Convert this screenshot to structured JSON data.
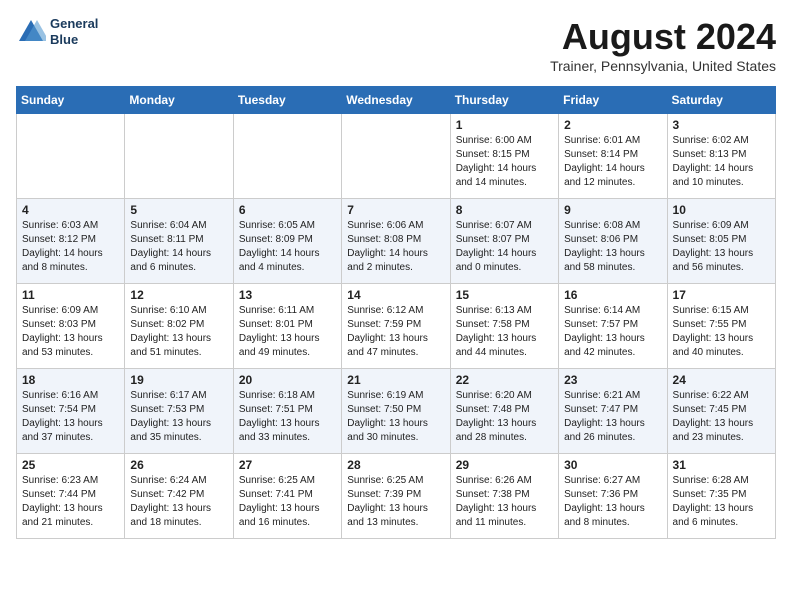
{
  "header": {
    "logo_line1": "General",
    "logo_line2": "Blue",
    "month": "August 2024",
    "location": "Trainer, Pennsylvania, United States"
  },
  "days_of_week": [
    "Sunday",
    "Monday",
    "Tuesday",
    "Wednesday",
    "Thursday",
    "Friday",
    "Saturday"
  ],
  "weeks": [
    [
      {
        "day": "",
        "info": ""
      },
      {
        "day": "",
        "info": ""
      },
      {
        "day": "",
        "info": ""
      },
      {
        "day": "",
        "info": ""
      },
      {
        "day": "1",
        "info": "Sunrise: 6:00 AM\nSunset: 8:15 PM\nDaylight: 14 hours\nand 14 minutes."
      },
      {
        "day": "2",
        "info": "Sunrise: 6:01 AM\nSunset: 8:14 PM\nDaylight: 14 hours\nand 12 minutes."
      },
      {
        "day": "3",
        "info": "Sunrise: 6:02 AM\nSunset: 8:13 PM\nDaylight: 14 hours\nand 10 minutes."
      }
    ],
    [
      {
        "day": "4",
        "info": "Sunrise: 6:03 AM\nSunset: 8:12 PM\nDaylight: 14 hours\nand 8 minutes."
      },
      {
        "day": "5",
        "info": "Sunrise: 6:04 AM\nSunset: 8:11 PM\nDaylight: 14 hours\nand 6 minutes."
      },
      {
        "day": "6",
        "info": "Sunrise: 6:05 AM\nSunset: 8:09 PM\nDaylight: 14 hours\nand 4 minutes."
      },
      {
        "day": "7",
        "info": "Sunrise: 6:06 AM\nSunset: 8:08 PM\nDaylight: 14 hours\nand 2 minutes."
      },
      {
        "day": "8",
        "info": "Sunrise: 6:07 AM\nSunset: 8:07 PM\nDaylight: 14 hours\nand 0 minutes."
      },
      {
        "day": "9",
        "info": "Sunrise: 6:08 AM\nSunset: 8:06 PM\nDaylight: 13 hours\nand 58 minutes."
      },
      {
        "day": "10",
        "info": "Sunrise: 6:09 AM\nSunset: 8:05 PM\nDaylight: 13 hours\nand 56 minutes."
      }
    ],
    [
      {
        "day": "11",
        "info": "Sunrise: 6:09 AM\nSunset: 8:03 PM\nDaylight: 13 hours\nand 53 minutes."
      },
      {
        "day": "12",
        "info": "Sunrise: 6:10 AM\nSunset: 8:02 PM\nDaylight: 13 hours\nand 51 minutes."
      },
      {
        "day": "13",
        "info": "Sunrise: 6:11 AM\nSunset: 8:01 PM\nDaylight: 13 hours\nand 49 minutes."
      },
      {
        "day": "14",
        "info": "Sunrise: 6:12 AM\nSunset: 7:59 PM\nDaylight: 13 hours\nand 47 minutes."
      },
      {
        "day": "15",
        "info": "Sunrise: 6:13 AM\nSunset: 7:58 PM\nDaylight: 13 hours\nand 44 minutes."
      },
      {
        "day": "16",
        "info": "Sunrise: 6:14 AM\nSunset: 7:57 PM\nDaylight: 13 hours\nand 42 minutes."
      },
      {
        "day": "17",
        "info": "Sunrise: 6:15 AM\nSunset: 7:55 PM\nDaylight: 13 hours\nand 40 minutes."
      }
    ],
    [
      {
        "day": "18",
        "info": "Sunrise: 6:16 AM\nSunset: 7:54 PM\nDaylight: 13 hours\nand 37 minutes."
      },
      {
        "day": "19",
        "info": "Sunrise: 6:17 AM\nSunset: 7:53 PM\nDaylight: 13 hours\nand 35 minutes."
      },
      {
        "day": "20",
        "info": "Sunrise: 6:18 AM\nSunset: 7:51 PM\nDaylight: 13 hours\nand 33 minutes."
      },
      {
        "day": "21",
        "info": "Sunrise: 6:19 AM\nSunset: 7:50 PM\nDaylight: 13 hours\nand 30 minutes."
      },
      {
        "day": "22",
        "info": "Sunrise: 6:20 AM\nSunset: 7:48 PM\nDaylight: 13 hours\nand 28 minutes."
      },
      {
        "day": "23",
        "info": "Sunrise: 6:21 AM\nSunset: 7:47 PM\nDaylight: 13 hours\nand 26 minutes."
      },
      {
        "day": "24",
        "info": "Sunrise: 6:22 AM\nSunset: 7:45 PM\nDaylight: 13 hours\nand 23 minutes."
      }
    ],
    [
      {
        "day": "25",
        "info": "Sunrise: 6:23 AM\nSunset: 7:44 PM\nDaylight: 13 hours\nand 21 minutes."
      },
      {
        "day": "26",
        "info": "Sunrise: 6:24 AM\nSunset: 7:42 PM\nDaylight: 13 hours\nand 18 minutes."
      },
      {
        "day": "27",
        "info": "Sunrise: 6:25 AM\nSunset: 7:41 PM\nDaylight: 13 hours\nand 16 minutes."
      },
      {
        "day": "28",
        "info": "Sunrise: 6:25 AM\nSunset: 7:39 PM\nDaylight: 13 hours\nand 13 minutes."
      },
      {
        "day": "29",
        "info": "Sunrise: 6:26 AM\nSunset: 7:38 PM\nDaylight: 13 hours\nand 11 minutes."
      },
      {
        "day": "30",
        "info": "Sunrise: 6:27 AM\nSunset: 7:36 PM\nDaylight: 13 hours\nand 8 minutes."
      },
      {
        "day": "31",
        "info": "Sunrise: 6:28 AM\nSunset: 7:35 PM\nDaylight: 13 hours\nand 6 minutes."
      }
    ]
  ]
}
